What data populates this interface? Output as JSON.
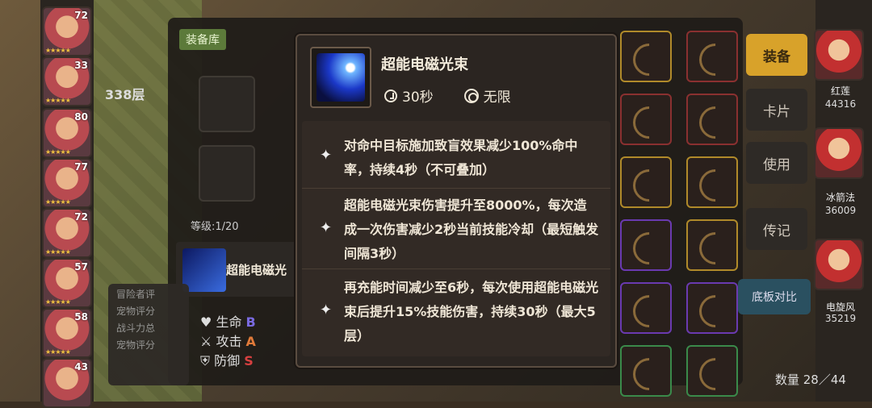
{
  "left_heroes": [
    {
      "level": "72"
    },
    {
      "level": "33"
    },
    {
      "level": "80"
    },
    {
      "level": "77"
    },
    {
      "level": "72"
    },
    {
      "level": "57"
    },
    {
      "level": "58"
    },
    {
      "level": "43"
    }
  ],
  "panel": {
    "tab": "装备库",
    "floor": "338层",
    "level": "等级:1/20",
    "skill_name": "超能电磁光",
    "side_labels": [
      "冒险者评",
      "宠物评分",
      "战斗力总",
      "宠物评分"
    ],
    "stats": [
      {
        "label": "生命",
        "grade": "B"
      },
      {
        "label": "攻击",
        "grade": "A"
      },
      {
        "label": "防御",
        "grade": "S"
      }
    ]
  },
  "tooltip": {
    "name": "超能电磁光束",
    "cooldown": "30秒",
    "range": "无限",
    "effects": [
      "对命中目标施加致盲效果减少100%命中率，持续4秒（不可叠加）",
      "超能电磁光束伤害提升至8000%，每次造成一次伤害减少2秒当前技能冷却（最短触发间隔3秒）",
      "再充能时间减少至6秒，每次使用超能电磁光束后提升15%技能伤害，持续30秒（最大5层）"
    ]
  },
  "buttons": {
    "equip": "装备",
    "card": "卡片",
    "use": "使用",
    "legend": "传记",
    "compare": "底板对比"
  },
  "right_heroes": [
    {
      "name": "红莲",
      "value": "44316"
    },
    {
      "name": "冰箭法",
      "value": "36009"
    },
    {
      "name": "电旋风",
      "value": "35219"
    }
  ],
  "count": "数量 28／44"
}
